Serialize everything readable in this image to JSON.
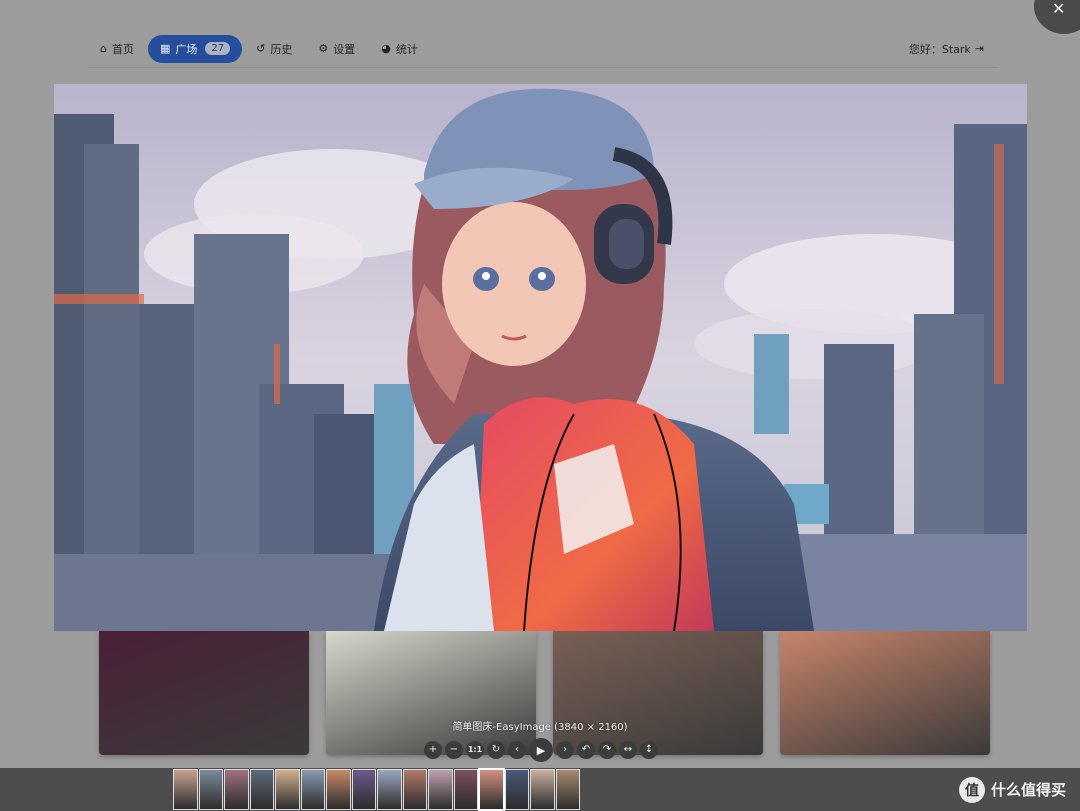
{
  "nav": {
    "items": [
      {
        "label": "首页",
        "icon": "home-icon",
        "glyph": "⌂"
      },
      {
        "label": "广场",
        "icon": "grid-icon",
        "glyph": "▦",
        "badge": "27",
        "active": true
      },
      {
        "label": "历史",
        "icon": "history-icon",
        "glyph": "↺"
      },
      {
        "label": "设置",
        "icon": "gear-icon",
        "glyph": "⚙"
      },
      {
        "label": "统计",
        "icon": "pie-chart-icon",
        "glyph": "◕"
      }
    ],
    "greeting": "您好：Stark",
    "logout_glyph": "⇥"
  },
  "viewer": {
    "caption": "简单图床-EasyImage (3840 × 2160)",
    "close_glyph": "✕",
    "toolbar": [
      {
        "name": "zoom-in",
        "glyph": "+"
      },
      {
        "name": "zoom-out",
        "glyph": "−"
      },
      {
        "name": "one-to-one",
        "glyph": "1:1"
      },
      {
        "name": "reset",
        "glyph": "↻"
      },
      {
        "name": "prev",
        "glyph": "‹"
      },
      {
        "name": "play",
        "glyph": "▶"
      },
      {
        "name": "next",
        "glyph": "›"
      },
      {
        "name": "rotate-left",
        "glyph": "↶"
      },
      {
        "name": "rotate-right",
        "glyph": "↷"
      },
      {
        "name": "flip-horizontal",
        "glyph": "↔"
      },
      {
        "name": "flip-vertical",
        "glyph": "↕"
      }
    ]
  },
  "thumbnails": {
    "count": 16,
    "active_index": 12,
    "colors": [
      "#c9a28f",
      "#7a8a9a",
      "#a07080",
      "#5b6a7c",
      "#d2b08a",
      "#8a9bb0",
      "#c98a6a",
      "#6d5a8a",
      "#9aa7c0",
      "#b07a6a",
      "#c0a0b0",
      "#7a5060",
      "#d49080",
      "#4a5a7a",
      "#c8b0a0",
      "#a88a70"
    ]
  },
  "gallery_colors": [
    "#4a2038",
    "#d6d8cc",
    "#7a6055",
    "#c8846a"
  ],
  "watermark": {
    "logo": "值",
    "text": "什么值得买"
  }
}
